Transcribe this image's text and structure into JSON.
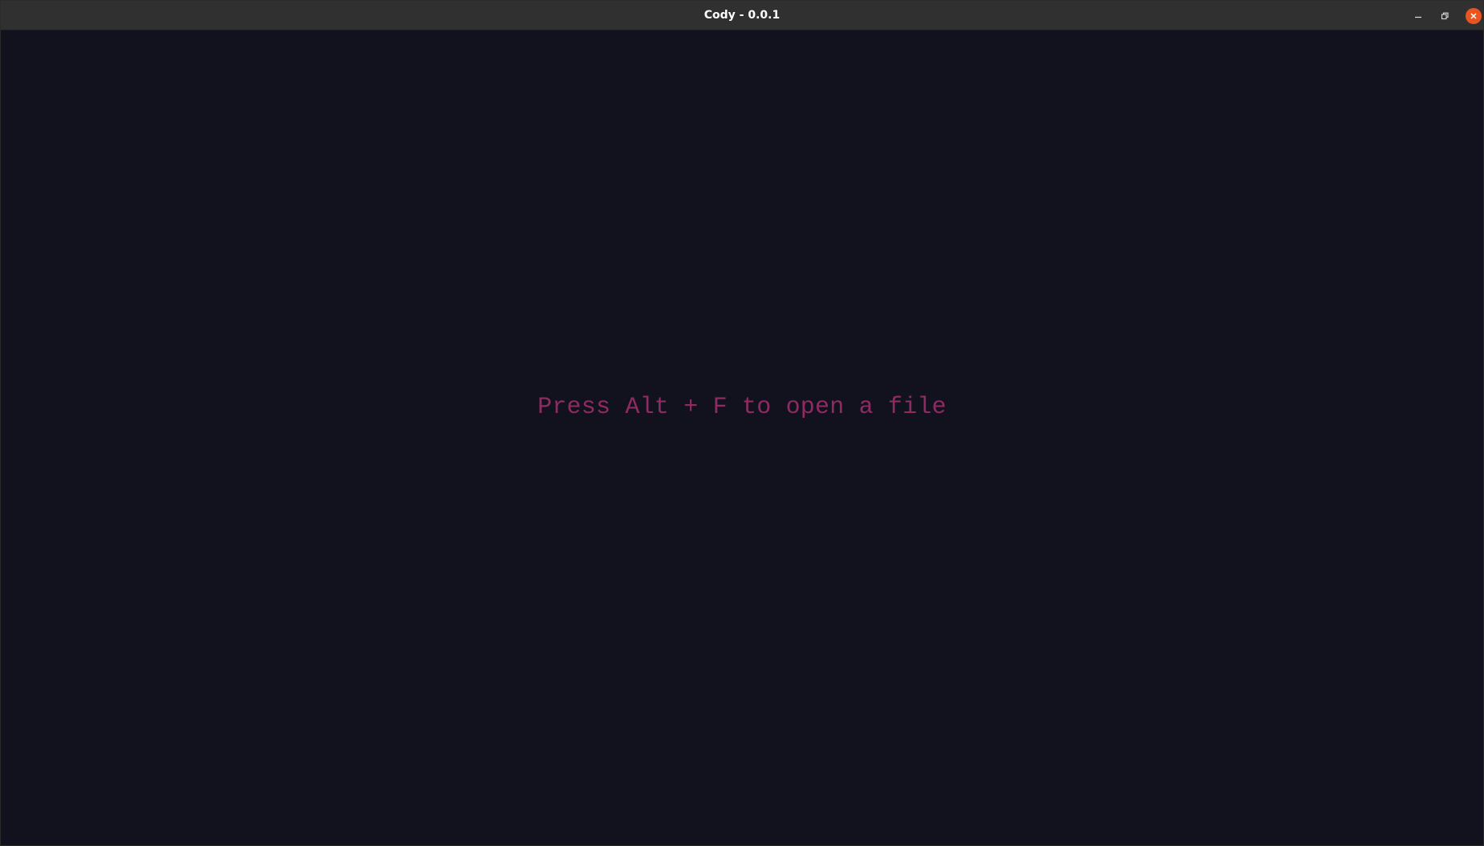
{
  "window": {
    "title": "Cody - 0.0.1",
    "controls": {
      "minimize_icon": "minimize-icon",
      "maximize_icon": "restore-icon",
      "close_icon": "close-icon"
    },
    "close_color": "#e95420"
  },
  "main": {
    "hint_text": "Press Alt + F to open a file",
    "hint_color": "#8f2a63",
    "background_color": "#12121f"
  }
}
